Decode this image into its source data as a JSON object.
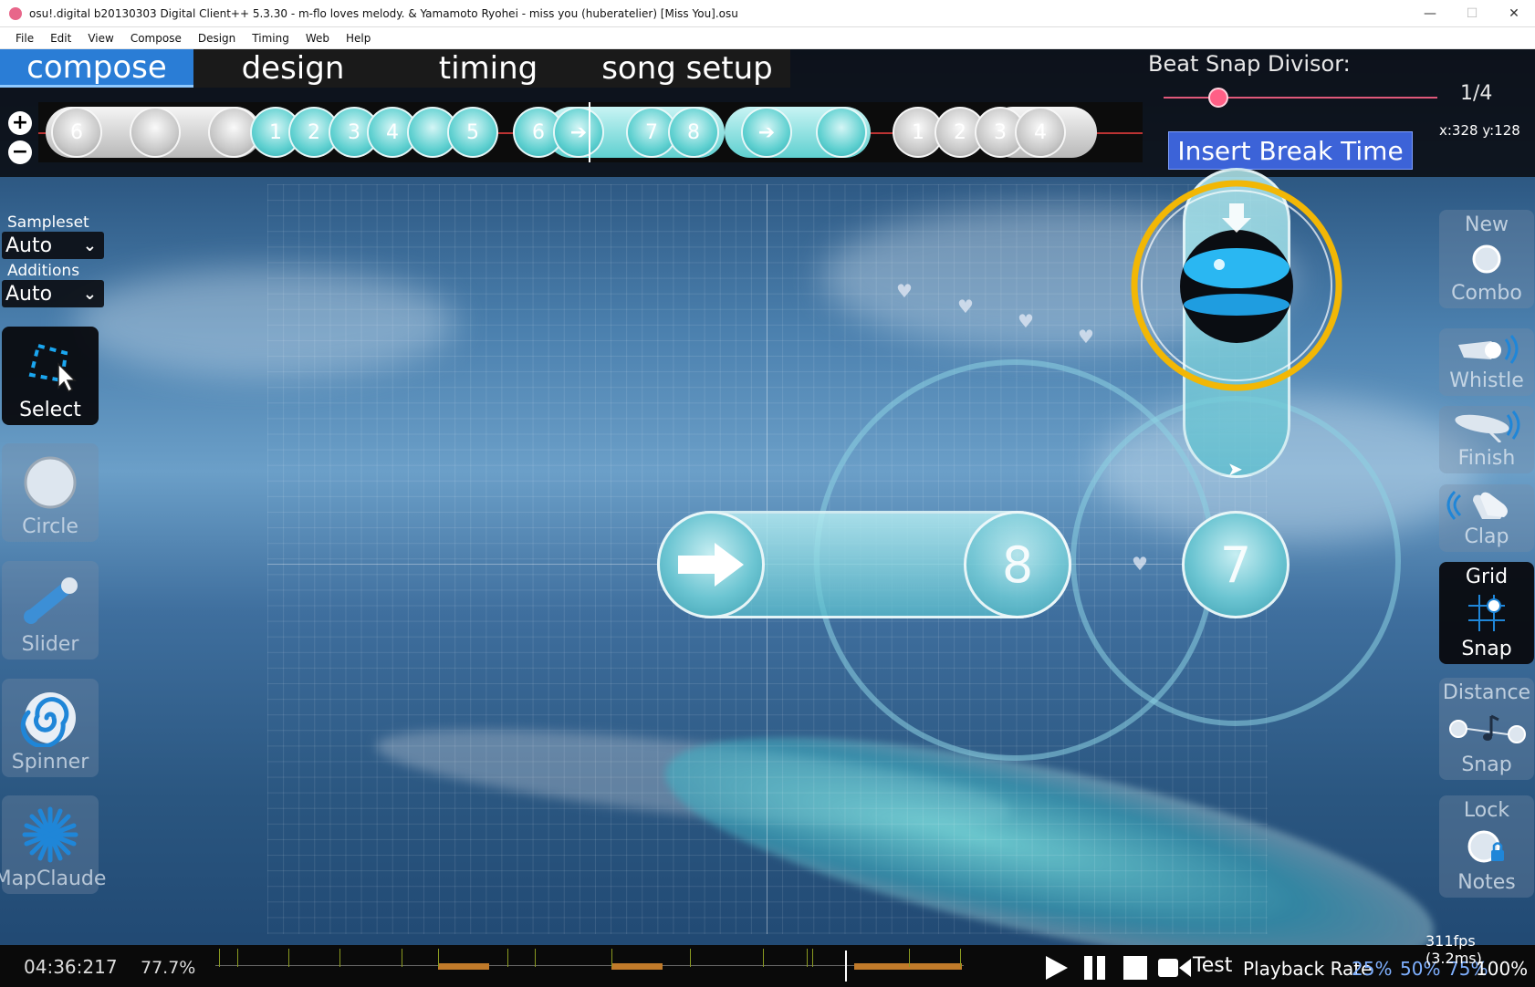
{
  "window": {
    "title": "osu!.digital b20130303 Digital Client++ 5.3.30 - m-flo loves melody. & Yamamoto Ryohei - miss you (huberatelier) [Miss You].osu",
    "minimize": "—",
    "maximize": "☐",
    "close": "✕"
  },
  "menu": [
    "File",
    "Edit",
    "View",
    "Compose",
    "Design",
    "Timing",
    "Web",
    "Help"
  ],
  "tabs": [
    {
      "label": "compose",
      "active": true
    },
    {
      "label": "design",
      "active": false
    },
    {
      "label": "timing",
      "active": false
    },
    {
      "label": "song setup",
      "active": false
    }
  ],
  "beat_snap": {
    "label": "Beat Snap Divisor:",
    "value": "1/4"
  },
  "insert_break": "Insert Break Time",
  "coords": "x:328 y:128",
  "timeline": {
    "numbers": [
      "6",
      "1",
      "2",
      "3",
      "4",
      "5",
      "6",
      "7",
      "8",
      "1",
      "2",
      "3",
      "4"
    ]
  },
  "left_panel": {
    "sampleset_label": "Sampleset",
    "sampleset_value": "Auto",
    "additions_label": "Additions",
    "additions_value": "Auto",
    "tools": [
      {
        "label": "Select",
        "icon": "select-icon",
        "active": true
      },
      {
        "label": "Circle",
        "icon": "circle-icon",
        "active": false
      },
      {
        "label": "Slider",
        "icon": "slider-icon",
        "active": false
      },
      {
        "label": "Spinner",
        "icon": "spinner-icon",
        "active": false
      },
      {
        "label": "MapClaude",
        "icon": "starburst-icon",
        "active": false
      }
    ]
  },
  "right_panel": {
    "new_combo": {
      "top": "New",
      "bottom": "Combo"
    },
    "whistle": "Whistle",
    "finish": "Finish",
    "clap": "Clap",
    "grid_snap": {
      "top": "Grid",
      "bottom": "Snap"
    },
    "distance_snap": {
      "top": "Distance",
      "bottom": "Snap"
    },
    "lock_notes": {
      "top": "Lock",
      "bottom": "Notes"
    }
  },
  "playfield": {
    "circle_numbers": {
      "slider_end": "8",
      "circle": "7"
    }
  },
  "bottom": {
    "time": "04:36:217",
    "percent": "77.7%",
    "test": "Test",
    "playback_label": "Playback Rate",
    "rates": [
      "25%",
      "50%",
      "75%",
      "100%"
    ],
    "selected_rate": "100%",
    "fps": "311fps (3.2ms)"
  },
  "colors": {
    "accent": "#2a7dd6",
    "break_button": "#3c63d8",
    "slider_knob": "#ff5f86",
    "hit_object": "#6cc5d2",
    "approach": "#f2b705"
  }
}
